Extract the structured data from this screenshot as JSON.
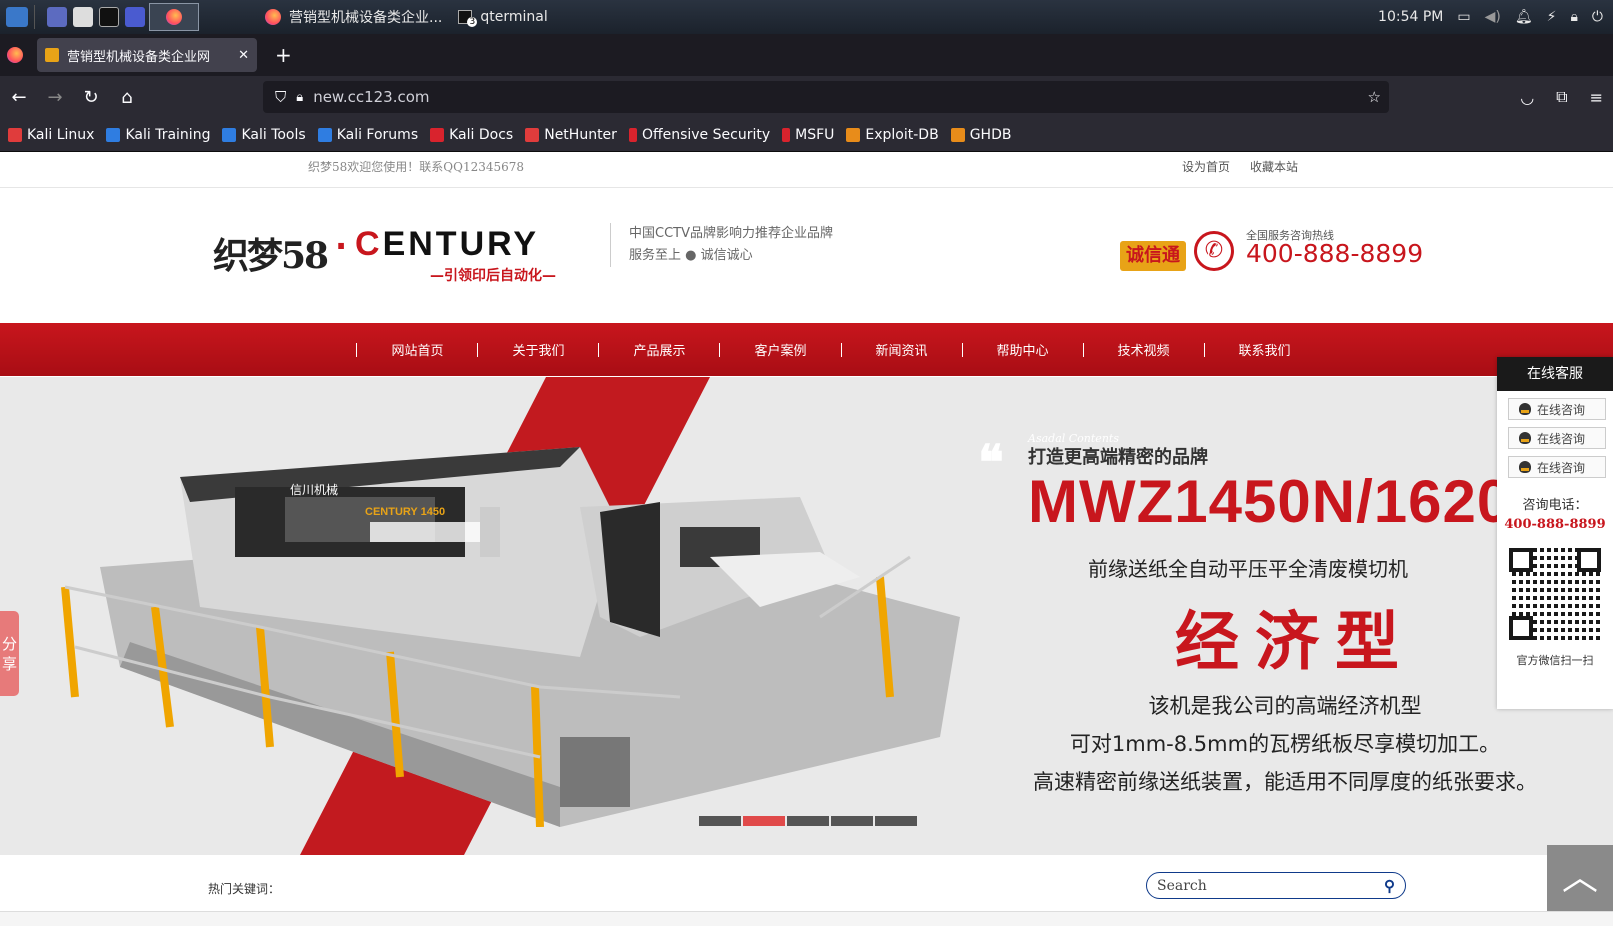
{
  "taskbar": {
    "windows": [
      {
        "title": "营销型机械设备类企业..."
      },
      {
        "title": "qterminal",
        "badge": "3"
      }
    ],
    "clock": "10:54 PM"
  },
  "browser": {
    "tab_title": "营销型机械设备类企业网",
    "new_tab": "+",
    "url": "new.cc123.com"
  },
  "bookmarks": [
    {
      "label": "Kali Linux",
      "color": "#e03c3c"
    },
    {
      "label": "Kali Training",
      "color": "#2f7de1"
    },
    {
      "label": "Kali Tools",
      "color": "#2f7de1"
    },
    {
      "label": "Kali Forums",
      "color": "#2f7de1"
    },
    {
      "label": "Kali Docs",
      "color": "#d9232d"
    },
    {
      "label": "NetHunter",
      "color": "#e03c3c"
    },
    {
      "label": "Offensive Security",
      "color": "#d9232d"
    },
    {
      "label": "MSFU",
      "color": "#d9232d"
    },
    {
      "label": "Exploit-DB",
      "color": "#e88c1a"
    },
    {
      "label": "GHDB",
      "color": "#e88c1a"
    }
  ],
  "site": {
    "welcome": "织梦58欢迎您使用！联系QQ12345678",
    "set_home": "设为首页",
    "favorite": "收藏本站",
    "logo_cn": "织梦58",
    "logo_dot": "·",
    "logo_en_c": "C",
    "logo_en_rest": "ENTURY",
    "logo_sub": "—引领印后自动化—",
    "slogan_line1": "中国CCTV品牌影响力推荐企业品牌",
    "slogan_line2": "服务至上 ● 诚信诚心",
    "badge": "诚信通",
    "hotline_label": "全国服务咨询热线",
    "hotline": "400-888-8899",
    "nav": [
      "网站首页",
      "关于我们",
      "产品展示",
      "客户案例",
      "新闻资讯",
      "帮助中心",
      "技术视频",
      "联系我们"
    ],
    "banner": {
      "quote_sub": "Asadal Contents",
      "tagline": "打造更高端精密的品牌",
      "model": "MWZ1450N/1620",
      "desc": "前缘送纸全自动平压平全清废模切机",
      "type": "经济型",
      "lines": [
        "该机是我公司的高端经济机型",
        "可对1mm-8.5mm的瓦楞纸板尽享模切加工。",
        "高速精密前缘送纸装置，能适用不同厚度的纸张要求。"
      ],
      "slides": 5,
      "active_slide": 2,
      "machine_brand": "信川机械",
      "machine_model": "CENTURY 1450"
    },
    "share": "分享",
    "service": {
      "title": "在线客服",
      "buttons": [
        "在线咨询",
        "在线咨询",
        "在线咨询"
      ],
      "tel_label": "咨询电话：",
      "tel": "400-888-8899",
      "wechat": "官方微信扫一扫"
    },
    "hot_keywords": "热门关键词：",
    "search_placeholder": "Search"
  }
}
